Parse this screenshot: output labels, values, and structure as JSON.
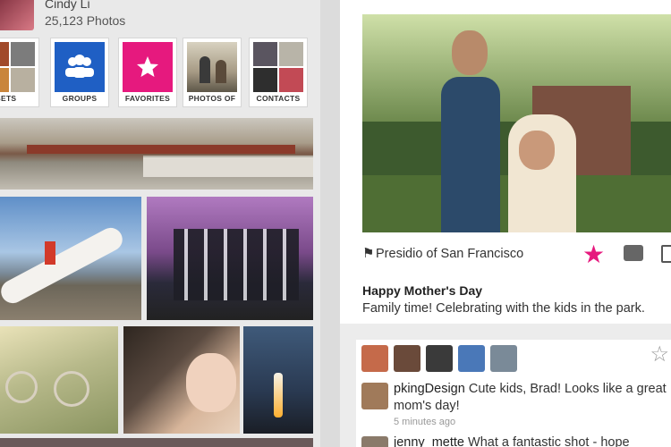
{
  "profile": {
    "name": "Cindy Li",
    "photo_count": "25,123 Photos"
  },
  "nav_tiles": [
    {
      "label": "SETS"
    },
    {
      "label": "GROUPS"
    },
    {
      "label": "FAVORITES"
    },
    {
      "label": "PHOTOS OF"
    },
    {
      "label": "CONTACTS"
    }
  ],
  "detail": {
    "location": "Presidio of San Francisco",
    "title": "Happy Mother's Day",
    "description": "Family time! Celebrating with the kids in the park."
  },
  "comments": [
    {
      "user": "pkingDesign",
      "text": " Cute kids, Brad! Looks like a great mom's day!",
      "time": "5 minutes ago"
    },
    {
      "user": "jenny_mette",
      "text": " What a fantastic shot - hope"
    }
  ],
  "colors": {
    "favorite_star": "#e6197e",
    "groups_tile": "#1f5fc4",
    "favorites_tile": "#e6197e"
  },
  "icons": {
    "location": "pin-icon",
    "favorite": "star-icon",
    "comment": "comment-icon",
    "share": "share-icon"
  }
}
